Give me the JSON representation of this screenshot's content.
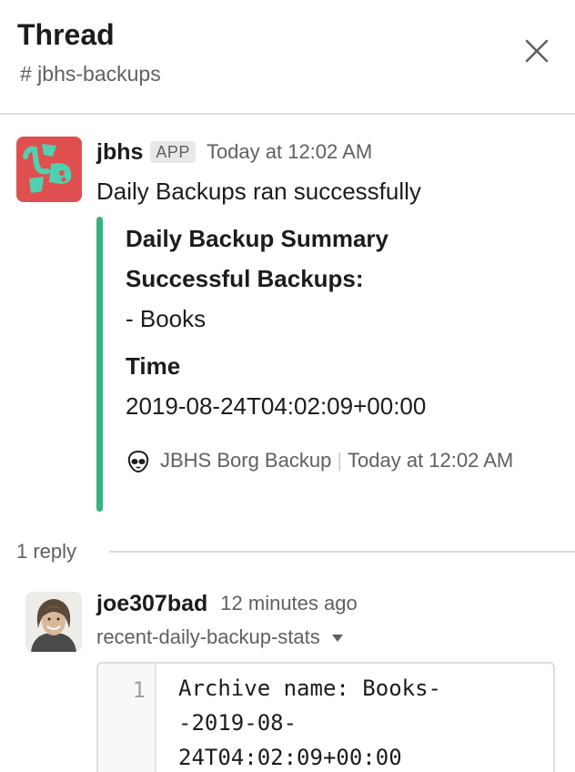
{
  "header": {
    "title": "Thread",
    "channel": "# jbhs-backups",
    "close_icon": "close-x-icon"
  },
  "parent_message": {
    "avatar_icon": "jbhs-app-logo",
    "sender": "jbhs",
    "badge": "APP",
    "timestamp": "Today at 12:02 AM",
    "text": "Daily Backups ran successfully",
    "attachment": {
      "accent_color": "#36b37e",
      "title": "Daily Backup Summary",
      "field1_label": "Successful Backups:",
      "field1_value": "- Books",
      "field2_label": "Time",
      "field2_value": "2019-08-24T04:02:09+00:00",
      "footer_icon": "alien-head-icon",
      "footer_source": "JBHS Borg Backup",
      "footer_separator": "|",
      "footer_time": "Today at 12:02 AM"
    }
  },
  "replies": {
    "count_label": "1 reply"
  },
  "reply_message": {
    "avatar_icon": "user-photo",
    "sender": "joe307bad",
    "timestamp": "12 minutes ago",
    "snippet_title": "recent-daily-backup-stats",
    "snippet_caret_icon": "caret-down-icon",
    "snippet": {
      "line_number": "1",
      "lines": [
        "Archive name: Books-",
        "-2019-08-",
        "24T04:02:09+00:00"
      ]
    }
  }
}
